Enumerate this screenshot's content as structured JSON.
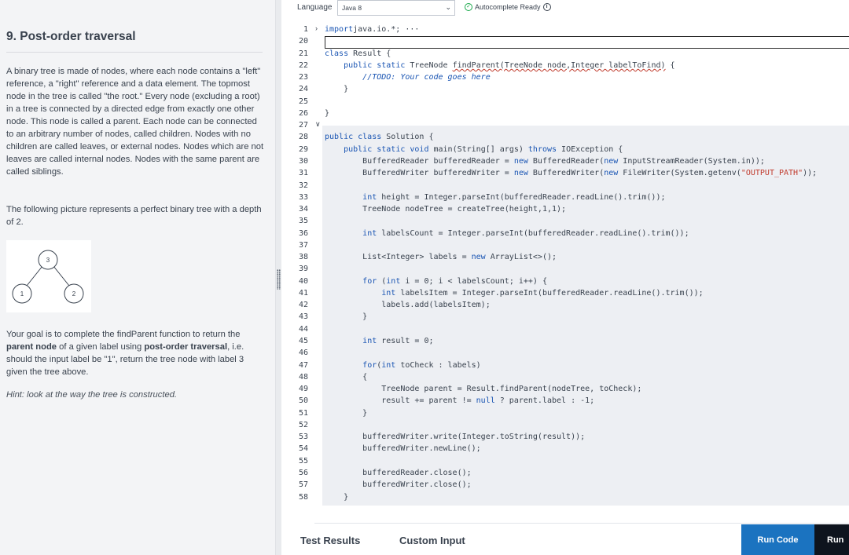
{
  "problem": {
    "title": "9. Post-order traversal",
    "p1": "A binary tree is made of nodes, where each node contains a \"left\" reference, a \"right\" reference and a data element. The topmost node in the tree is called \"the root.\" Every node (excluding a root) in a tree is connected by a directed edge from exactly one other node. This node is called a parent. Each node can be connected to an arbitrary number of nodes, called children. Nodes with no children are called leaves, or external nodes. Nodes which are not leaves are called internal nodes. Nodes with the same parent are called siblings.",
    "p2": "The following picture represents a perfect binary tree with a depth of 2.",
    "p3_a": "Your goal is to complete the findParent function to return the ",
    "p3_b": "parent node",
    "p3_c": " of a given label using ",
    "p3_d": "post-order traversal",
    "p3_e": ", i.e. should the input label be \"1\", return the tree node with label 3 given the tree above.",
    "hint": "Hint: look at the way the tree is constructed.",
    "tree": {
      "root": "3",
      "left": "1",
      "right": "2"
    }
  },
  "toolbar": {
    "language_label": "Language",
    "language_value": "Java 8",
    "autocomplete": "Autocomplete Ready"
  },
  "editor": {
    "lines": [
      {
        "n": "1",
        "fold": ">",
        "segs": [
          [
            "kw",
            "import"
          ],
          [
            "",
            "java.io.*;"
          ],
          [
            "",
            " ···"
          ]
        ]
      },
      {
        "n": "20",
        "segs": []
      },
      {
        "n": "21",
        "segs": [
          [
            "kw",
            "class"
          ],
          [
            "",
            " Result {"
          ]
        ]
      },
      {
        "n": "22",
        "segs": [
          [
            "",
            "    "
          ],
          [
            "kw",
            "public"
          ],
          [
            "",
            ""
          ],
          [
            "kw",
            " static"
          ],
          [
            "",
            " TreeNode "
          ],
          [
            "squig",
            "findParent(TreeNode node,Integer labelToFind)"
          ],
          [
            "",
            " {"
          ]
        ]
      },
      {
        "n": "23",
        "segs": [
          [
            "",
            "        "
          ],
          [
            "cm",
            "//TODO: Your code goes here"
          ]
        ]
      },
      {
        "n": "24",
        "segs": [
          [
            "",
            "    }"
          ]
        ]
      },
      {
        "n": "25",
        "segs": []
      },
      {
        "n": "26",
        "segs": [
          [
            "",
            "}"
          ]
        ]
      },
      {
        "n": "27",
        "fold": "v",
        "segs": []
      },
      {
        "n": "28",
        "segs": [
          [
            "kw",
            "public class"
          ],
          [
            "",
            " Solution {"
          ]
        ]
      },
      {
        "n": "29",
        "segs": [
          [
            "",
            "    "
          ],
          [
            "kw",
            "public static void"
          ],
          [
            "",
            " main(String[] args) "
          ],
          [
            "kw",
            "throws"
          ],
          [
            "",
            " IOException {"
          ]
        ]
      },
      {
        "n": "30",
        "segs": [
          [
            "",
            "        BufferedReader bufferedReader = "
          ],
          [
            "kw",
            "new"
          ],
          [
            "",
            " BufferedReader("
          ],
          [
            "kw",
            "new"
          ],
          [
            "",
            " InputStreamReader(System.in));"
          ]
        ]
      },
      {
        "n": "31",
        "segs": [
          [
            "",
            "        BufferedWriter bufferedWriter = "
          ],
          [
            "kw",
            "new"
          ],
          [
            "",
            " BufferedWriter("
          ],
          [
            "kw",
            "new"
          ],
          [
            "",
            " FileWriter(System.getenv("
          ],
          [
            "str",
            "\"OUTPUT_PATH\""
          ],
          [
            "",
            "));"
          ]
        ]
      },
      {
        "n": "32",
        "segs": []
      },
      {
        "n": "33",
        "segs": [
          [
            "",
            "        "
          ],
          [
            "kw",
            "int"
          ],
          [
            "",
            " height = Integer.parseInt(bufferedReader.readLine().trim());"
          ]
        ]
      },
      {
        "n": "34",
        "segs": [
          [
            "",
            "        TreeNode nodeTree = createTree(height,1,1);"
          ]
        ]
      },
      {
        "n": "35",
        "segs": []
      },
      {
        "n": "36",
        "segs": [
          [
            "",
            "        "
          ],
          [
            "kw",
            "int"
          ],
          [
            "",
            " labelsCount = Integer.parseInt(bufferedReader.readLine().trim());"
          ]
        ]
      },
      {
        "n": "37",
        "segs": []
      },
      {
        "n": "38",
        "segs": [
          [
            "",
            "        List<Integer> labels = "
          ],
          [
            "kw",
            "new"
          ],
          [
            "",
            " ArrayList<>();"
          ]
        ]
      },
      {
        "n": "39",
        "segs": []
      },
      {
        "n": "40",
        "segs": [
          [
            "",
            "        "
          ],
          [
            "kw",
            "for"
          ],
          [
            "",
            " ("
          ],
          [
            "kw",
            "int"
          ],
          [
            "",
            " i = 0; i < labelsCount; i++) {"
          ]
        ]
      },
      {
        "n": "41",
        "segs": [
          [
            "",
            "            "
          ],
          [
            "kw",
            "int"
          ],
          [
            "",
            " labelsItem = Integer.parseInt(bufferedReader.readLine().trim());"
          ]
        ]
      },
      {
        "n": "42",
        "segs": [
          [
            "",
            "            labels.add(labelsItem);"
          ]
        ]
      },
      {
        "n": "43",
        "segs": [
          [
            "",
            "        }"
          ]
        ]
      },
      {
        "n": "44",
        "segs": []
      },
      {
        "n": "45",
        "segs": [
          [
            "",
            "        "
          ],
          [
            "kw",
            "int"
          ],
          [
            "",
            " result = 0;"
          ]
        ]
      },
      {
        "n": "46",
        "segs": []
      },
      {
        "n": "47",
        "segs": [
          [
            "",
            "        "
          ],
          [
            "kw",
            "for"
          ],
          [
            "",
            "("
          ],
          [
            "kw",
            "int"
          ],
          [
            "",
            " toCheck : labels)"
          ]
        ]
      },
      {
        "n": "48",
        "segs": [
          [
            "",
            "        {"
          ]
        ]
      },
      {
        "n": "49",
        "segs": [
          [
            "",
            "            TreeNode parent = Result.findParent(nodeTree, toCheck);"
          ]
        ]
      },
      {
        "n": "50",
        "segs": [
          [
            "",
            "            result += parent != "
          ],
          [
            "kw",
            "null"
          ],
          [
            "",
            " ? parent.label : -1;"
          ]
        ]
      },
      {
        "n": "51",
        "segs": [
          [
            "",
            "        }"
          ]
        ]
      },
      {
        "n": "52",
        "segs": []
      },
      {
        "n": "53",
        "segs": [
          [
            "",
            "        bufferedWriter.write(Integer.toString(result));"
          ]
        ]
      },
      {
        "n": "54",
        "segs": [
          [
            "",
            "        bufferedWriter.newLine();"
          ]
        ]
      },
      {
        "n": "55",
        "segs": []
      },
      {
        "n": "56",
        "segs": [
          [
            "",
            "        bufferedReader.close();"
          ]
        ]
      },
      {
        "n": "57",
        "segs": [
          [
            "",
            "        bufferedWriter.close();"
          ]
        ]
      },
      {
        "n": "58",
        "segs": [
          [
            "",
            "    }"
          ]
        ]
      }
    ]
  },
  "bottom": {
    "test_results": "Test Results",
    "custom_input": "Custom Input",
    "run_code": "Run Code",
    "run_tests": "Run"
  }
}
